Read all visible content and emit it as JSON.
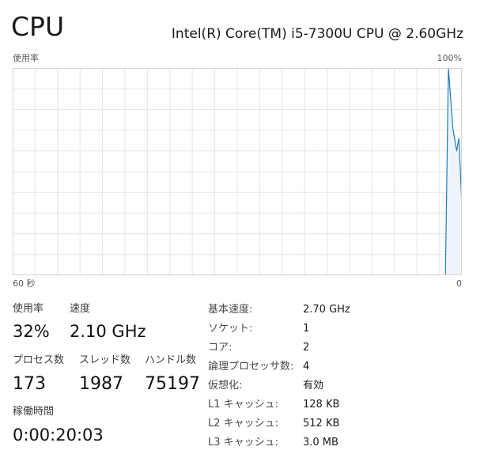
{
  "header": {
    "title": "CPU",
    "processor": "Intel(R) Core(TM) i5-7300U CPU @ 2.60GHz"
  },
  "graph": {
    "y_label": "使用率",
    "y_max_label": "100%",
    "x_start_label": "60 秒",
    "x_end_label": "0",
    "line_color": "#1f7bb8",
    "fill_color": "#eef4fa",
    "grid_color": "#e5e5e5",
    "border_color": "#d4d4d4",
    "usage_series_percent": [
      0,
      100,
      71,
      60,
      66,
      34
    ],
    "usage_series_seconds_ago": [
      2.2,
      1.8,
      1.2,
      0.7,
      0.4,
      0
    ]
  },
  "stats": {
    "utilization": {
      "label": "使用率",
      "value": "32%"
    },
    "speed": {
      "label": "速度",
      "value": "2.10 GHz"
    },
    "processes": {
      "label": "プロセス数",
      "value": "173"
    },
    "threads": {
      "label": "スレッド数",
      "value": "1987"
    },
    "handles": {
      "label": "ハンドル数",
      "value": "75197"
    },
    "uptime": {
      "label": "稼働時間",
      "value": "0:00:20:03"
    }
  },
  "specs": [
    {
      "label": "基本速度:",
      "value": "2.70 GHz"
    },
    {
      "label": "ソケット:",
      "value": "1"
    },
    {
      "label": "コア:",
      "value": "2"
    },
    {
      "label": "論理プロセッサ数:",
      "value": "4"
    },
    {
      "label": "仮想化:",
      "value": "有効"
    },
    {
      "label": "L1 キャッシュ:",
      "value": "128 KB"
    },
    {
      "label": "L2 キャッシュ:",
      "value": "512 KB"
    },
    {
      "label": "L3 キャッシュ:",
      "value": "3.0 MB"
    }
  ]
}
